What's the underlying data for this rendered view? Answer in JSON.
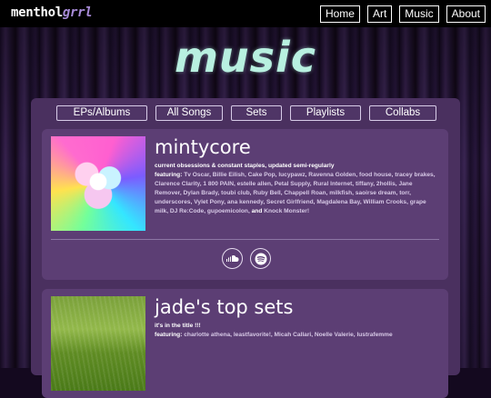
{
  "header": {
    "logo_main": "menthol",
    "logo_accent": "grrl",
    "nav": [
      {
        "label": "Home"
      },
      {
        "label": "Art"
      },
      {
        "label": "Music"
      },
      {
        "label": "About"
      }
    ]
  },
  "page": {
    "title": "music"
  },
  "tabs": [
    {
      "label": "EPs/Albums"
    },
    {
      "label": "All Songs"
    },
    {
      "label": "Sets"
    },
    {
      "label": "Playlists"
    },
    {
      "label": "Collabs"
    }
  ],
  "cards": [
    {
      "title": "mintycore",
      "subtitle": "current obsessions & constant staples, updated semi-regularly",
      "featuring_label": "featuring:",
      "featuring_artists": "Tv Oscar, Billie Eilish, Cake Pop, lucypawz, Ravenna Golden, food house, tracey brakes, Clarence Clarity, 1 800 PAIN, estelle allen, Petal Supply, Rural Internet, tiffany, 2hollis, Jane Remover, Dylan Brady, toubi club, Ruby Bell, Chappell Roan, milkfish, saoirse dream, torr, underscores, Vylet Pony, ana kennedy, Secret Girlfriend, Magdalena Bay, William Crooks, grape milk, DJ Re:Code, gupoemicolon,",
      "featuring_and": "and",
      "featuring_last": "Knock Monster!",
      "links": [
        {
          "icon": "soundcloud-icon"
        },
        {
          "icon": "spotify-icon"
        }
      ]
    },
    {
      "title": "jade's top sets",
      "subtitle": "it's in the title !!!",
      "featuring_label": "featuring:",
      "featuring_artists": "charlotte athena, leastfavorite!, Micah Callari, Noelle Valerie, lustrafemme"
    }
  ],
  "colors": {
    "title_mint": "#b8f0e0",
    "panel": "#4a305f",
    "card": "#5c3e74",
    "logo_accent": "#a88bd8"
  }
}
